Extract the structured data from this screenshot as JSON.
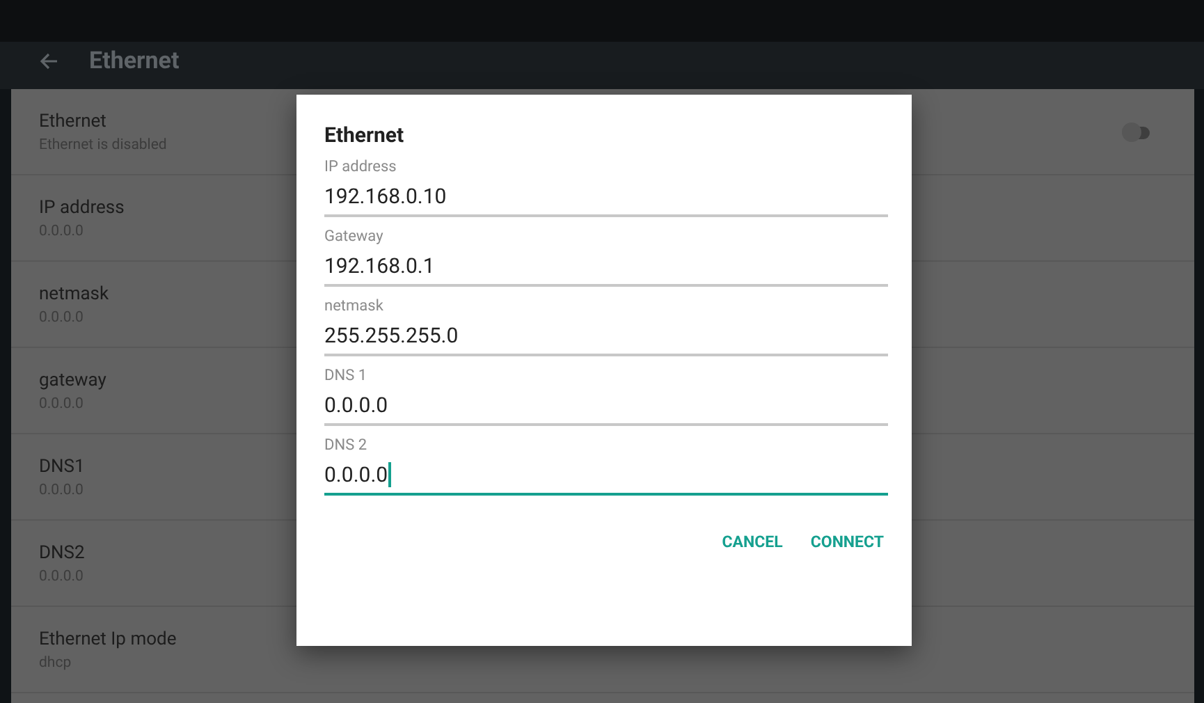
{
  "toolbar": {
    "title": "Ethernet"
  },
  "settings": [
    {
      "title": "Ethernet",
      "subtitle": "Ethernet is disabled",
      "kind": "toggle",
      "on": false
    },
    {
      "title": "IP address",
      "subtitle": "0.0.0.0",
      "kind": "text"
    },
    {
      "title": "netmask",
      "subtitle": "0.0.0.0",
      "kind": "text"
    },
    {
      "title": "gateway",
      "subtitle": "0.0.0.0",
      "kind": "text"
    },
    {
      "title": "DNS1",
      "subtitle": "0.0.0.0",
      "kind": "text"
    },
    {
      "title": "DNS2",
      "subtitle": "0.0.0.0",
      "kind": "text"
    },
    {
      "title": "Ethernet Ip mode",
      "subtitle": "dhcp",
      "kind": "text"
    }
  ],
  "dialog": {
    "title": "Ethernet",
    "fields": [
      {
        "label": "IP address",
        "value": "192.168.0.10",
        "focused": false
      },
      {
        "label": "Gateway",
        "value": "192.168.0.1",
        "focused": false
      },
      {
        "label": "netmask",
        "value": "255.255.255.0",
        "focused": false
      },
      {
        "label": "DNS 1",
        "value": "0.0.0.0",
        "focused": false
      },
      {
        "label": "DNS 2",
        "value": "0.0.0.0",
        "focused": true
      }
    ],
    "buttons": [
      "CANCEL",
      "CONNECT"
    ]
  }
}
